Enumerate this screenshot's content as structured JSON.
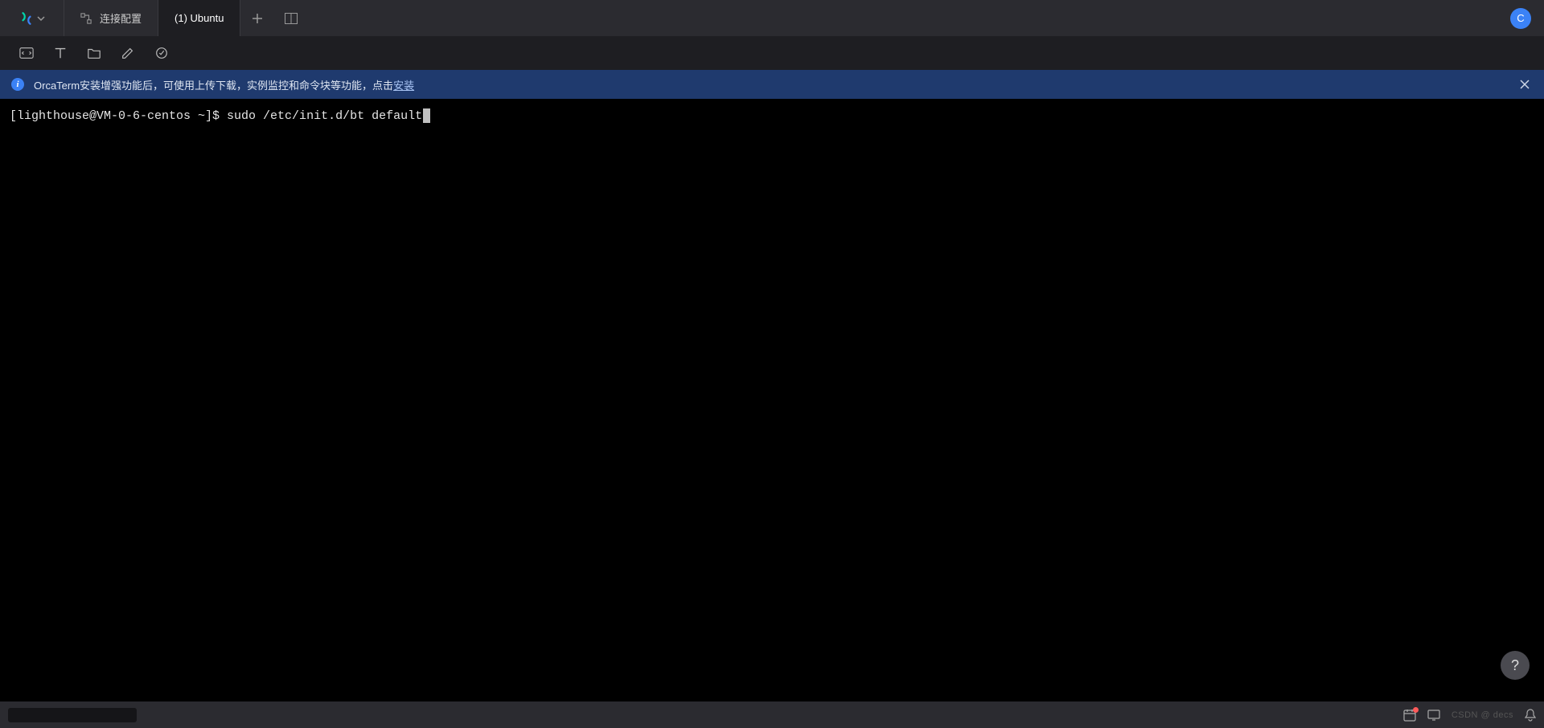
{
  "tabs": {
    "connection": {
      "label": "连接配置"
    },
    "active": {
      "label": "(1) Ubuntu"
    }
  },
  "avatar": {
    "letter": "C"
  },
  "banner": {
    "text_before": "OrcaTerm安装增强功能后，可使用上传下载，实例监控和命令块等功能，点击",
    "link": "安装"
  },
  "terminal": {
    "prompt": "[lighthouse@VM-0-6-centos ~]$ ",
    "command": "sudo /etc/init.d/bt default"
  },
  "status": {
    "watermark": "CSDN @ decs"
  },
  "help": {
    "label": "?"
  },
  "icons": {
    "plus": "plus-icon",
    "split": "split-icon"
  }
}
